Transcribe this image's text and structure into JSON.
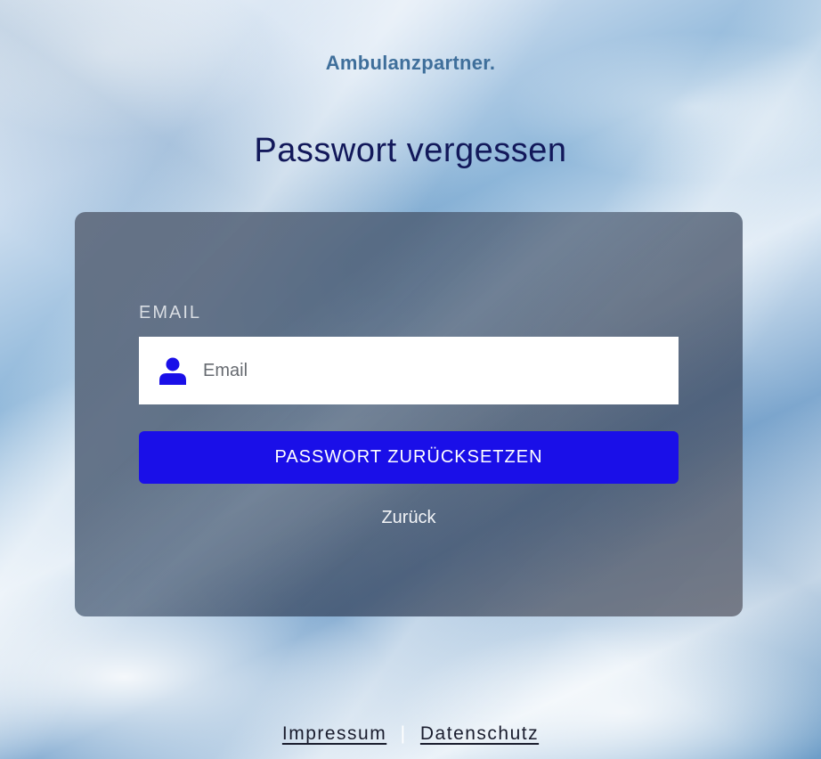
{
  "brand": {
    "logo_text": "Ambulanzpartner."
  },
  "page": {
    "title": "Passwort vergessen"
  },
  "form": {
    "email_label": "EMAIL",
    "email_placeholder": "Email",
    "email_value": "",
    "email_icon": "user-icon",
    "submit_label": "PASSWORT ZURÜCKSETZEN",
    "back_label": "Zurück"
  },
  "footer": {
    "impressum_label": "Impressum",
    "separator": "|",
    "datenschutz_label": "Datenschutz"
  },
  "colors": {
    "title": "#12185a",
    "logo": "#3f6f9b",
    "primary_button": "#1a0fe8",
    "user_icon": "#1a0fe8"
  }
}
